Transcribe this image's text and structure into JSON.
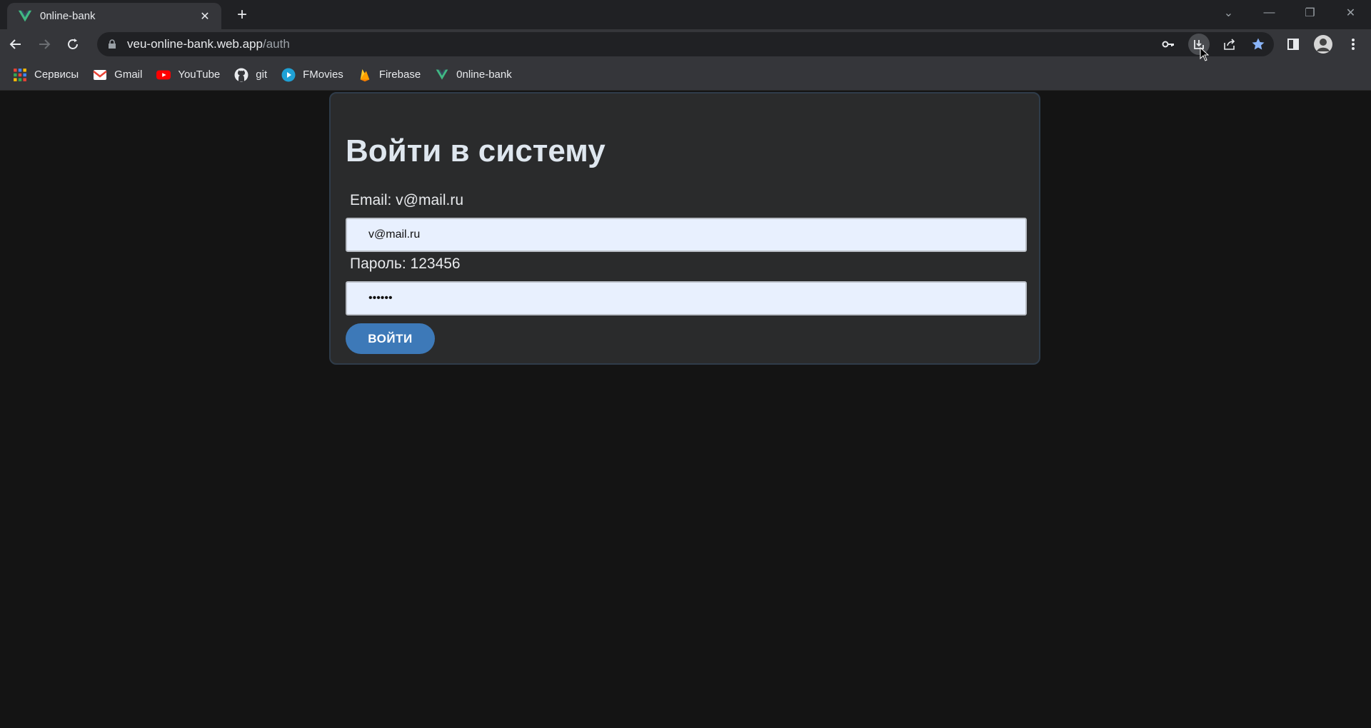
{
  "browser": {
    "tab_title": "0nline-bank",
    "url_host": "veu-online-bank.web.app",
    "url_path": "/auth"
  },
  "bookmarks": [
    {
      "label": "Сервисы",
      "icon": "apps-grid-icon"
    },
    {
      "label": "Gmail",
      "icon": "gmail-icon"
    },
    {
      "label": "YouTube",
      "icon": "youtube-icon"
    },
    {
      "label": "git",
      "icon": "github-icon"
    },
    {
      "label": "FMovies",
      "icon": "fmovies-icon"
    },
    {
      "label": "Firebase",
      "icon": "firebase-icon"
    },
    {
      "label": "0nline-bank",
      "icon": "vue-icon"
    }
  ],
  "auth": {
    "title": "Войти в систему",
    "email_label": "Email: v@mail.ru",
    "email_value": "v@mail.ru",
    "password_label": "Пароль: 123456",
    "password_value": "••••••",
    "submit_label": "ВОЙТИ"
  },
  "colors": {
    "page_bg": "#141414",
    "card_bg": "#2a2b2c",
    "button_bg": "#3d79b8",
    "input_bg": "#e8f0fe"
  }
}
